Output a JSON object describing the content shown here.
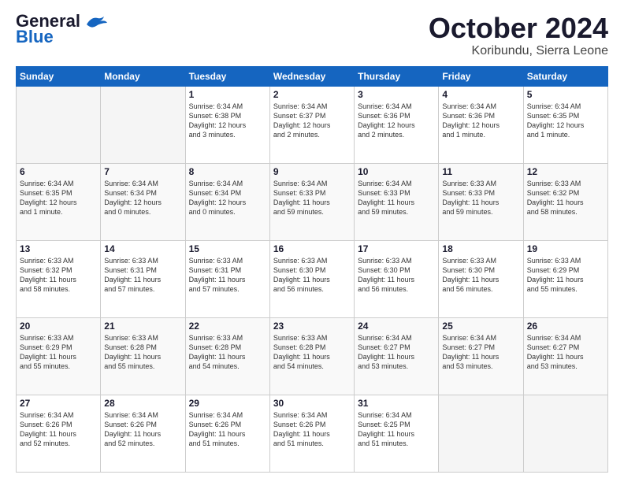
{
  "header": {
    "logo_line1": "General",
    "logo_line2": "Blue",
    "title": "October 2024",
    "subtitle": "Koribundu, Sierra Leone"
  },
  "days_of_week": [
    "Sunday",
    "Monday",
    "Tuesday",
    "Wednesday",
    "Thursday",
    "Friday",
    "Saturday"
  ],
  "weeks": [
    [
      {
        "day": "",
        "info": ""
      },
      {
        "day": "",
        "info": ""
      },
      {
        "day": "1",
        "info": "Sunrise: 6:34 AM\nSunset: 6:38 PM\nDaylight: 12 hours\nand 3 minutes."
      },
      {
        "day": "2",
        "info": "Sunrise: 6:34 AM\nSunset: 6:37 PM\nDaylight: 12 hours\nand 2 minutes."
      },
      {
        "day": "3",
        "info": "Sunrise: 6:34 AM\nSunset: 6:36 PM\nDaylight: 12 hours\nand 2 minutes."
      },
      {
        "day": "4",
        "info": "Sunrise: 6:34 AM\nSunset: 6:36 PM\nDaylight: 12 hours\nand 1 minute."
      },
      {
        "day": "5",
        "info": "Sunrise: 6:34 AM\nSunset: 6:35 PM\nDaylight: 12 hours\nand 1 minute."
      }
    ],
    [
      {
        "day": "6",
        "info": "Sunrise: 6:34 AM\nSunset: 6:35 PM\nDaylight: 12 hours\nand 1 minute."
      },
      {
        "day": "7",
        "info": "Sunrise: 6:34 AM\nSunset: 6:34 PM\nDaylight: 12 hours\nand 0 minutes."
      },
      {
        "day": "8",
        "info": "Sunrise: 6:34 AM\nSunset: 6:34 PM\nDaylight: 12 hours\nand 0 minutes."
      },
      {
        "day": "9",
        "info": "Sunrise: 6:34 AM\nSunset: 6:33 PM\nDaylight: 11 hours\nand 59 minutes."
      },
      {
        "day": "10",
        "info": "Sunrise: 6:34 AM\nSunset: 6:33 PM\nDaylight: 11 hours\nand 59 minutes."
      },
      {
        "day": "11",
        "info": "Sunrise: 6:33 AM\nSunset: 6:33 PM\nDaylight: 11 hours\nand 59 minutes."
      },
      {
        "day": "12",
        "info": "Sunrise: 6:33 AM\nSunset: 6:32 PM\nDaylight: 11 hours\nand 58 minutes."
      }
    ],
    [
      {
        "day": "13",
        "info": "Sunrise: 6:33 AM\nSunset: 6:32 PM\nDaylight: 11 hours\nand 58 minutes."
      },
      {
        "day": "14",
        "info": "Sunrise: 6:33 AM\nSunset: 6:31 PM\nDaylight: 11 hours\nand 57 minutes."
      },
      {
        "day": "15",
        "info": "Sunrise: 6:33 AM\nSunset: 6:31 PM\nDaylight: 11 hours\nand 57 minutes."
      },
      {
        "day": "16",
        "info": "Sunrise: 6:33 AM\nSunset: 6:30 PM\nDaylight: 11 hours\nand 56 minutes."
      },
      {
        "day": "17",
        "info": "Sunrise: 6:33 AM\nSunset: 6:30 PM\nDaylight: 11 hours\nand 56 minutes."
      },
      {
        "day": "18",
        "info": "Sunrise: 6:33 AM\nSunset: 6:30 PM\nDaylight: 11 hours\nand 56 minutes."
      },
      {
        "day": "19",
        "info": "Sunrise: 6:33 AM\nSunset: 6:29 PM\nDaylight: 11 hours\nand 55 minutes."
      }
    ],
    [
      {
        "day": "20",
        "info": "Sunrise: 6:33 AM\nSunset: 6:29 PM\nDaylight: 11 hours\nand 55 minutes."
      },
      {
        "day": "21",
        "info": "Sunrise: 6:33 AM\nSunset: 6:28 PM\nDaylight: 11 hours\nand 55 minutes."
      },
      {
        "day": "22",
        "info": "Sunrise: 6:33 AM\nSunset: 6:28 PM\nDaylight: 11 hours\nand 54 minutes."
      },
      {
        "day": "23",
        "info": "Sunrise: 6:33 AM\nSunset: 6:28 PM\nDaylight: 11 hours\nand 54 minutes."
      },
      {
        "day": "24",
        "info": "Sunrise: 6:34 AM\nSunset: 6:27 PM\nDaylight: 11 hours\nand 53 minutes."
      },
      {
        "day": "25",
        "info": "Sunrise: 6:34 AM\nSunset: 6:27 PM\nDaylight: 11 hours\nand 53 minutes."
      },
      {
        "day": "26",
        "info": "Sunrise: 6:34 AM\nSunset: 6:27 PM\nDaylight: 11 hours\nand 53 minutes."
      }
    ],
    [
      {
        "day": "27",
        "info": "Sunrise: 6:34 AM\nSunset: 6:26 PM\nDaylight: 11 hours\nand 52 minutes."
      },
      {
        "day": "28",
        "info": "Sunrise: 6:34 AM\nSunset: 6:26 PM\nDaylight: 11 hours\nand 52 minutes."
      },
      {
        "day": "29",
        "info": "Sunrise: 6:34 AM\nSunset: 6:26 PM\nDaylight: 11 hours\nand 51 minutes."
      },
      {
        "day": "30",
        "info": "Sunrise: 6:34 AM\nSunset: 6:26 PM\nDaylight: 11 hours\nand 51 minutes."
      },
      {
        "day": "31",
        "info": "Sunrise: 6:34 AM\nSunset: 6:25 PM\nDaylight: 11 hours\nand 51 minutes."
      },
      {
        "day": "",
        "info": ""
      },
      {
        "day": "",
        "info": ""
      }
    ]
  ]
}
